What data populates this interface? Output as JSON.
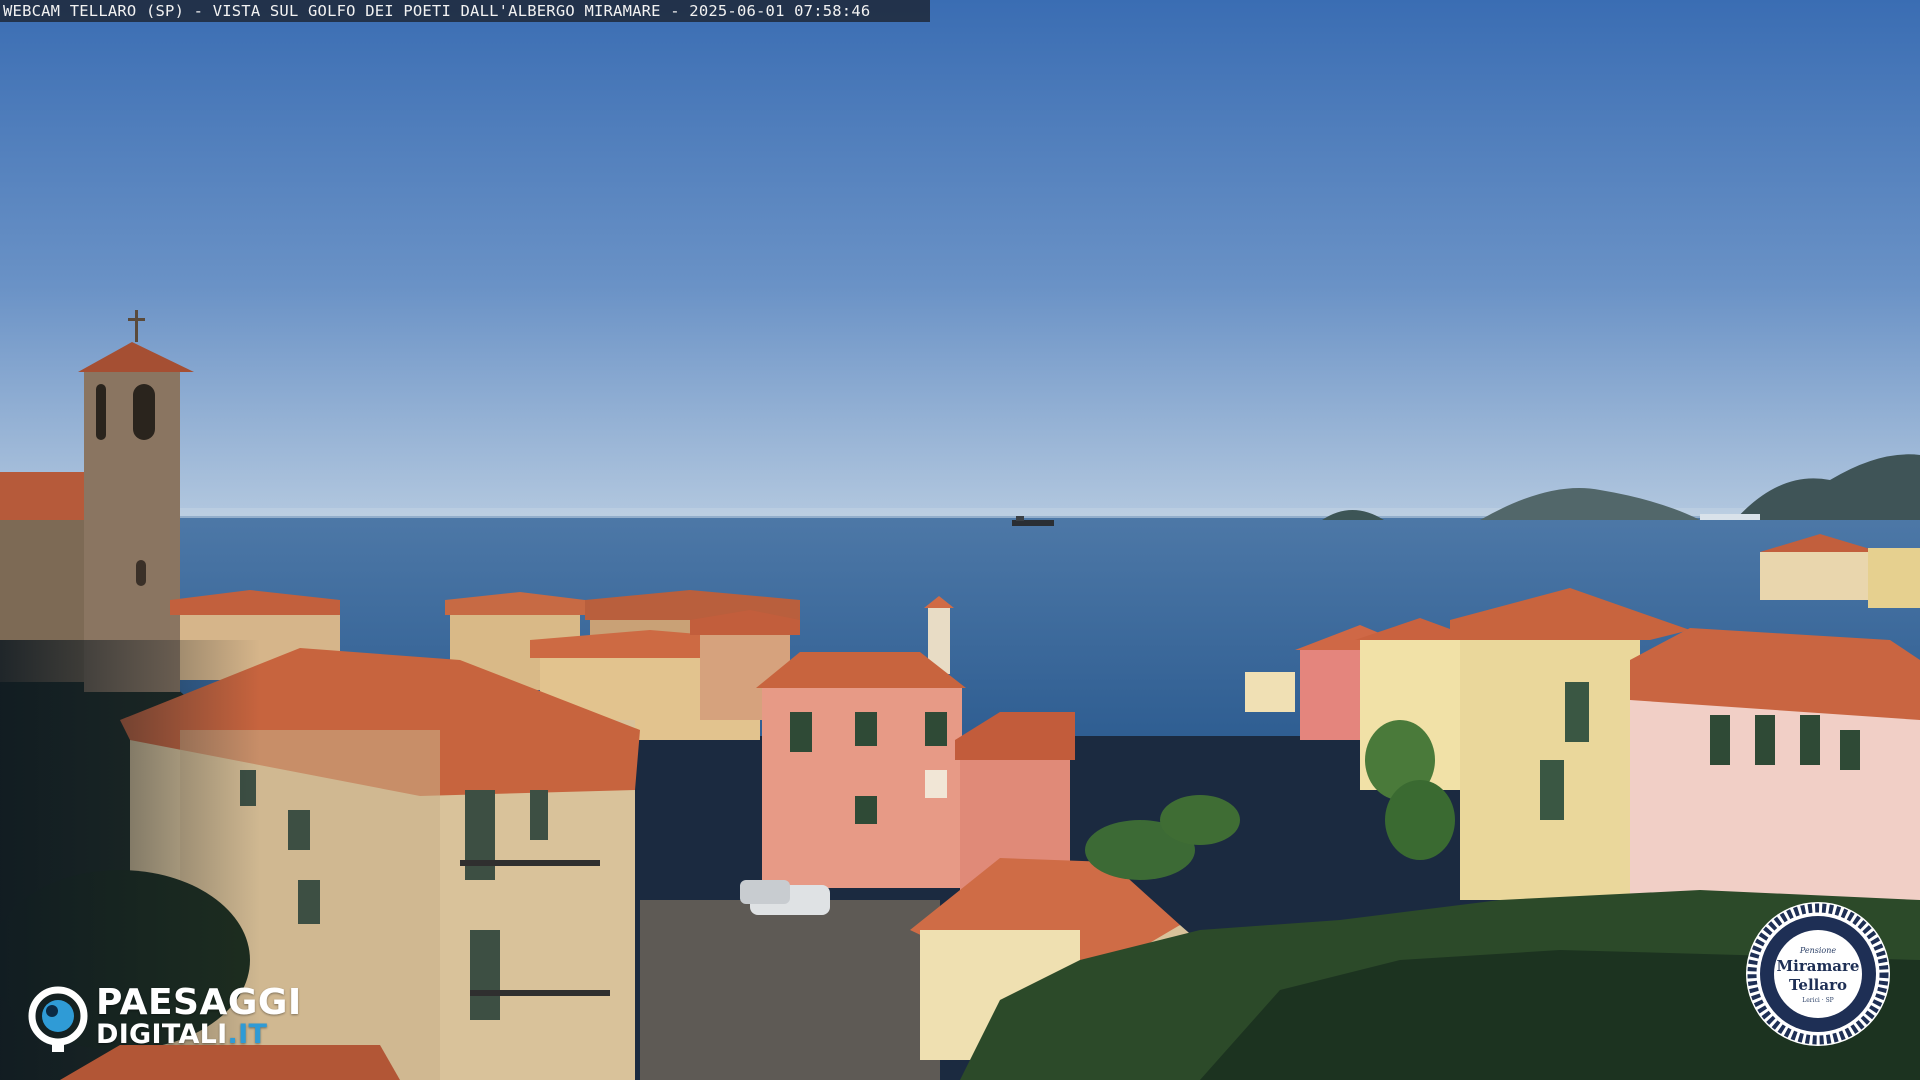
{
  "overlay": {
    "caption": "WEBCAM TELLARO (SP) - VISTA SUL GOLFO DEI POETI DALL'ALBERGO MIRAMARE - 2025-06-01 07:58:46"
  },
  "watermark_left": {
    "line1": "PAESAGGI",
    "line2_main": "DIGITALI",
    "line2_tld": ".IT",
    "icon": "eye-icon",
    "accent_color": "#2f9bd6"
  },
  "watermark_right": {
    "small": "Pensione",
    "name1": "Miramare",
    "name2": "Tellaro",
    "sub": "Lerici · SP",
    "icon": "rope-badge-icon",
    "color": "#1e2f55"
  },
  "colors": {
    "sky_top": "#3c6fb5",
    "sky_horizon": "#a7c1dd",
    "sea": "#3f6fa0",
    "roof": "#c8643e",
    "pink_building": "#e79a86",
    "yellow_building": "#ead79b"
  }
}
